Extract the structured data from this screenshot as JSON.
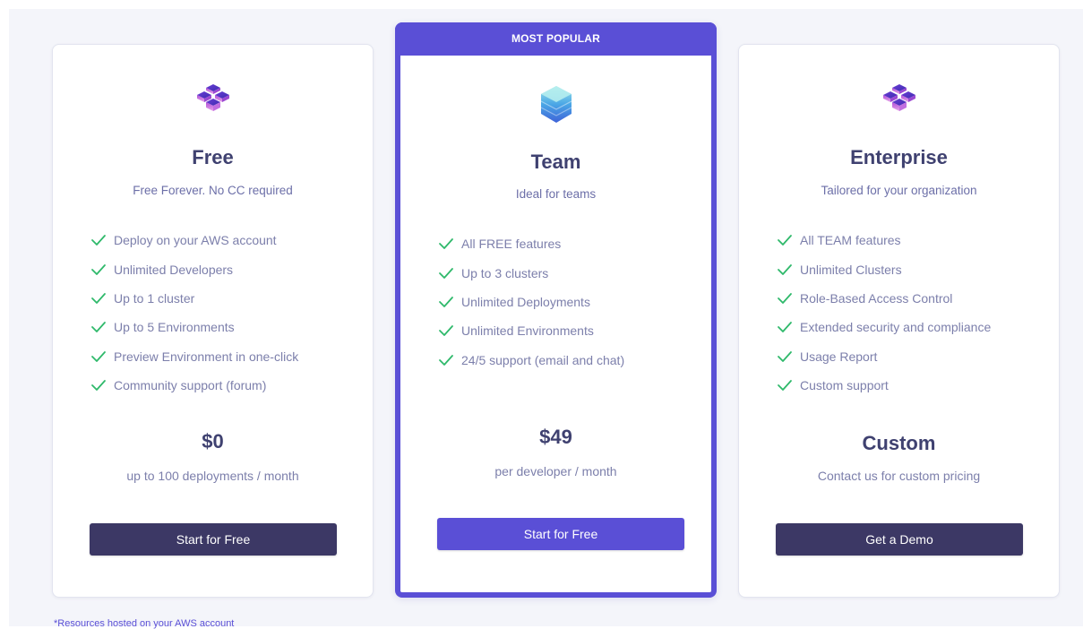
{
  "plans": [
    {
      "name": "Free",
      "tagline": "Free Forever. No CC required",
      "icon": "cubes-icon",
      "features": [
        "Deploy on your AWS account",
        "Unlimited Developers",
        "Up to 1 cluster",
        "Up to 5 Environments",
        "Preview Environment in one-click",
        "Community support (forum)"
      ],
      "price": "$0",
      "price_note": "up to 100 deployments / month",
      "cta": "Start for Free"
    },
    {
      "badge": "MOST POPULAR",
      "name": "Team",
      "tagline": "Ideal for teams",
      "icon": "stack-icon",
      "features": [
        "All FREE features",
        "Up to 3 clusters",
        "Unlimited Deployments",
        "Unlimited Environments",
        "24/5 support (email and chat)"
      ],
      "price": "$49",
      "price_note": "per developer / month",
      "cta": "Start for Free"
    },
    {
      "name": "Enterprise",
      "tagline": "Tailored for your organization",
      "icon": "cubes-icon",
      "features": [
        "All TEAM features",
        "Unlimited Clusters",
        "Role-Based Access Control",
        "Extended security and compliance",
        "Usage Report",
        "Custom support"
      ],
      "price": "Custom",
      "price_note": "Contact us for custom pricing",
      "cta": "Get a Demo"
    }
  ],
  "footnote": "*Resources hosted on your AWS account",
  "colors": {
    "accent": "#5a4fd6",
    "dark_button": "#3c3865",
    "check": "#2fb96b",
    "title": "#3f4170",
    "muted": "#7c7fab",
    "background": "#f4f5fa"
  }
}
